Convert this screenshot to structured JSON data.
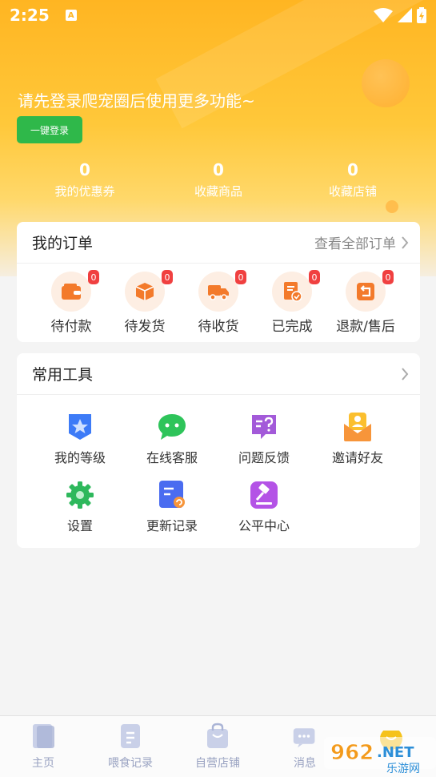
{
  "status_bar": {
    "time": "2:25",
    "notif_letter": "A"
  },
  "header": {
    "login_prompt": "请先登录爬宠圈后使用更多功能~",
    "login_button": "一键登录"
  },
  "stats": [
    {
      "value": "0",
      "label": "我的优惠券"
    },
    {
      "value": "0",
      "label": "收藏商品"
    },
    {
      "value": "0",
      "label": "收藏店铺"
    }
  ],
  "orders": {
    "title": "我的订单",
    "view_all": "查看全部订单",
    "items": [
      {
        "label": "待付款",
        "badge": "0",
        "icon": "wallet-icon"
      },
      {
        "label": "待发货",
        "badge": "0",
        "icon": "package-icon"
      },
      {
        "label": "待收货",
        "badge": "0",
        "icon": "truck-icon"
      },
      {
        "label": "已完成",
        "badge": "0",
        "icon": "completed-doc-icon"
      },
      {
        "label": "退款/售后",
        "badge": "0",
        "icon": "refund-icon"
      }
    ]
  },
  "tools": {
    "title": "常用工具",
    "items": [
      {
        "label": "我的等级",
        "icon": "level-star-icon",
        "color": "#3d7bf7"
      },
      {
        "label": "在线客服",
        "icon": "chat-bubble-icon",
        "color": "#2ec45a"
      },
      {
        "label": "问题反馈",
        "icon": "question-feedback-icon",
        "color": "#a35ad9"
      },
      {
        "label": "邀请好友",
        "icon": "invite-envelope-icon",
        "color": "#f7953a"
      },
      {
        "label": "设置",
        "icon": "gear-icon",
        "color": "#2eb85c"
      },
      {
        "label": "更新记录",
        "icon": "update-log-icon",
        "color": "#4a6cf0"
      },
      {
        "label": "公平中心",
        "icon": "gavel-icon",
        "color": "#b453e6"
      }
    ]
  },
  "tabbar": [
    {
      "label": "主页",
      "icon": "home-icon"
    },
    {
      "label": "喂食记录",
      "icon": "feeding-record-icon"
    },
    {
      "label": "自营店铺",
      "icon": "shop-bag-icon"
    },
    {
      "label": "消息",
      "icon": "message-icon"
    }
  ],
  "watermark": {
    "text": "962.NET",
    "subtext": "乐游网"
  },
  "colors": {
    "header_orange": "#ffb522",
    "login_green": "#2fb84a",
    "badge_red": "#f04040",
    "order_icon_orange": "#f37a2b",
    "tab_gray": "#9aa3c2"
  }
}
